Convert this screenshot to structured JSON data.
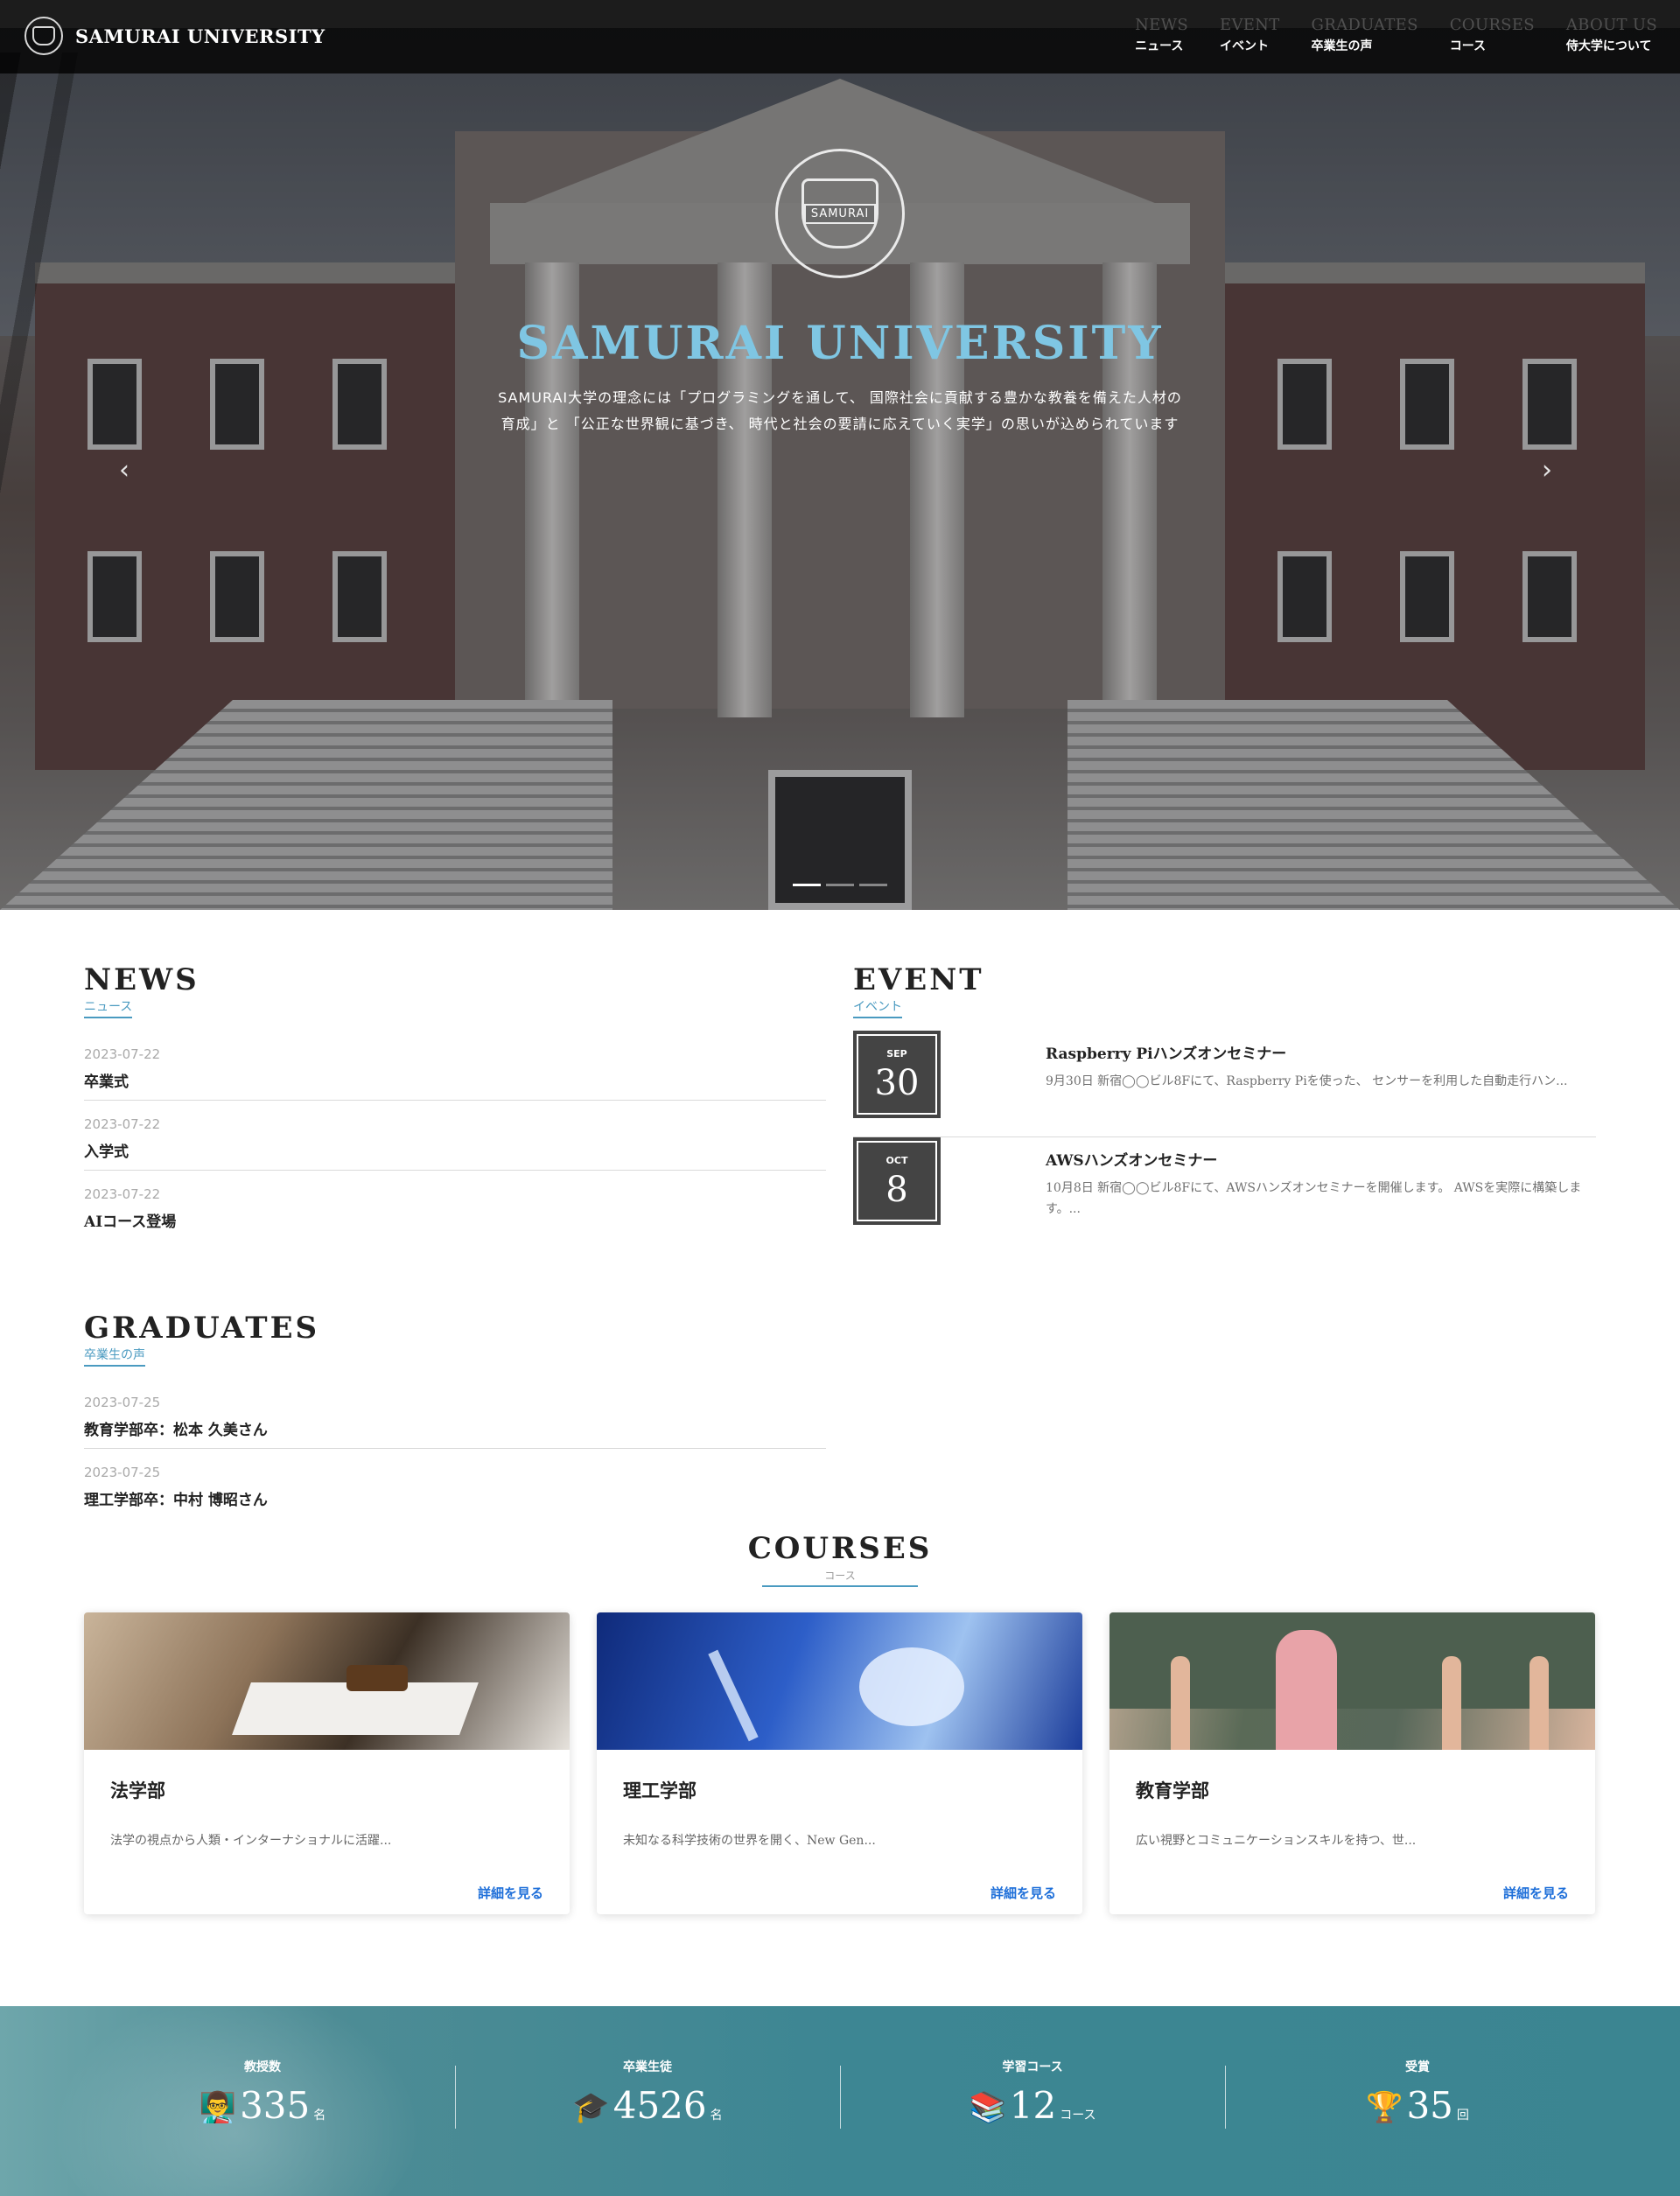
{
  "header": {
    "brand": "SAMURAI UNIVERSITY",
    "nav": [
      {
        "en": "NEWS",
        "jp": "ニュース"
      },
      {
        "en": "EVENT",
        "jp": "イベント"
      },
      {
        "en": "GRADUATES",
        "jp": "卒業生の声"
      },
      {
        "en": "COURSES",
        "jp": "コース"
      },
      {
        "en": "ABOUT US",
        "jp": "侍大学について"
      }
    ]
  },
  "hero": {
    "emblem_text": "SAMURAI",
    "title": "SAMURAI UNIVERSITY",
    "text_line1": "SAMURAI大学の理念には「プログラミングを通して、 国際社会に貢献する豊かな教養を備えた人材の",
    "text_line2": "育成」と 「公正な世界観に基づき、 時代と社会の要請に応えていく実学」の思いが込められています",
    "prev_arrow": "‹",
    "next_arrow": "›",
    "slides": 3,
    "active_slide": 1
  },
  "news": {
    "title": "NEWS",
    "subtitle": "ニュース",
    "items": [
      {
        "date": "2023-07-22",
        "title": "卒業式"
      },
      {
        "date": "2023-07-22",
        "title": "入学式"
      },
      {
        "date": "2023-07-22",
        "title": "AIコース登場"
      }
    ]
  },
  "event": {
    "title": "EVENT",
    "subtitle": "イベント",
    "items": [
      {
        "month": "SEP",
        "day": "30",
        "title": "Raspberry Piハンズオンセミナー",
        "desc": "9月30日 新宿◯◯ビル8Fにて、Raspberry Piを使った、 センサーを利用した自動走行ハン..."
      },
      {
        "month": "OCT",
        "day": "8",
        "title": "AWSハンズオンセミナー",
        "desc": "10月8日 新宿◯◯ビル8Fにて、AWSハンズオンセミナーを開催します。 AWSを実際に構築します。..."
      }
    ]
  },
  "graduates": {
    "title": "GRADUATES",
    "subtitle": "卒業生の声",
    "items": [
      {
        "date": "2023-07-25",
        "title": "教育学部卒：松本 久美さん"
      },
      {
        "date": "2023-07-25",
        "title": "理工学部卒：中村 博昭さん"
      }
    ]
  },
  "courses": {
    "title": "COURSES",
    "subtitle": "コース",
    "link_label": "詳細を見る",
    "items": [
      {
        "title": "法学部",
        "desc": "法学の視点から人類・インターナショナルに活躍..."
      },
      {
        "title": "理工学部",
        "desc": "未知なる科学技術の世界を開く、New Gen..."
      },
      {
        "title": "教育学部",
        "desc": "広い視野とコミュニケーションスキルを持つ、世..."
      }
    ]
  },
  "stats": [
    {
      "label": "教授数",
      "icon": "teacher-icon",
      "value": "335",
      "unit": "名"
    },
    {
      "label": "卒業生徒",
      "icon": "graduate-icon",
      "value": "4526",
      "unit": "名"
    },
    {
      "label": "学習コース",
      "icon": "books-icon",
      "value": "12",
      "unit": "コース"
    },
    {
      "label": "受賞",
      "icon": "trophy-icon",
      "value": "35",
      "unit": "回"
    }
  ],
  "colors": {
    "accent": "#4a9ac0",
    "hero_title": "#7fc6e3",
    "link": "#1e6fd9",
    "stats_band": "#3d8693"
  }
}
